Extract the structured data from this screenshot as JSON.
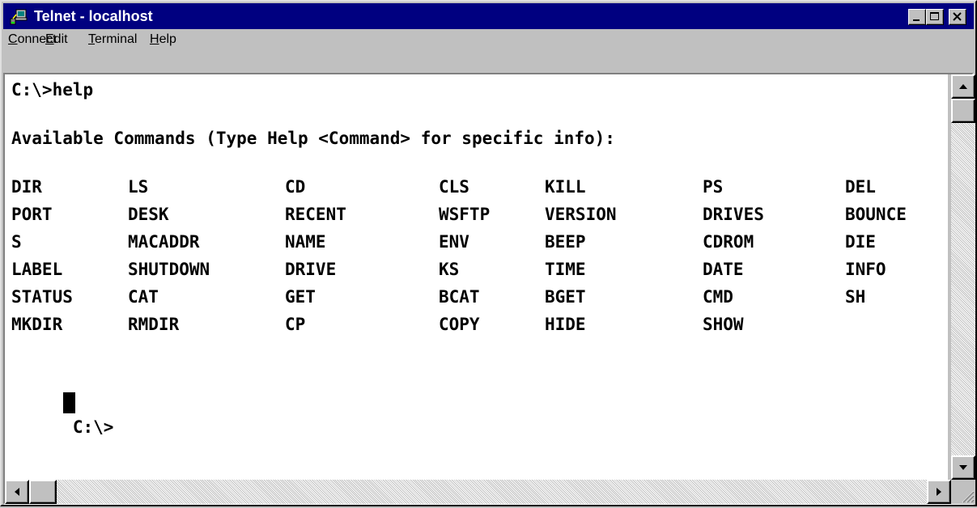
{
  "window": {
    "title": "Telnet - localhost",
    "icon": "telnet-computer-icon",
    "controls": [
      "minimize-icon",
      "maximize-icon",
      "close-icon"
    ]
  },
  "menu": {
    "items": [
      {
        "label": "Connect",
        "mnemonic": "C"
      },
      {
        "label": "Edit",
        "mnemonic": "E"
      },
      {
        "label": "Terminal",
        "mnemonic": "T"
      },
      {
        "label": "Help",
        "mnemonic": "H"
      }
    ]
  },
  "terminal": {
    "command_line": "C:\\>help",
    "header": "Available Commands (Type Help <Command> for specific info):",
    "commands": [
      [
        "DIR",
        "LS",
        "CD",
        "CLS",
        "KILL",
        "PS",
        "DEL"
      ],
      [
        "PORT",
        "DESK",
        "RECENT",
        "WSFTP",
        "VERSION",
        "DRIVES",
        "BOUNCE"
      ],
      [
        "S",
        "MACADDR",
        "NAME",
        "ENV",
        "BEEP",
        "CDROM",
        "DIE"
      ],
      [
        "LABEL",
        "SHUTDOWN",
        "DRIVE",
        "KS",
        "TIME",
        "DATE",
        "INFO"
      ],
      [
        "STATUS",
        "CAT",
        "GET",
        "BCAT",
        "BGET",
        "CMD",
        "SH"
      ],
      [
        "MKDIR",
        "RMDIR",
        "CP",
        "COPY",
        "HIDE",
        "SHOW",
        ""
      ]
    ],
    "prompt": "C:\\>"
  },
  "colors": {
    "titlebar": "#000080",
    "face": "#c0c0c0",
    "terminal_bg": "#ffffff",
    "terminal_fg": "#000000"
  }
}
